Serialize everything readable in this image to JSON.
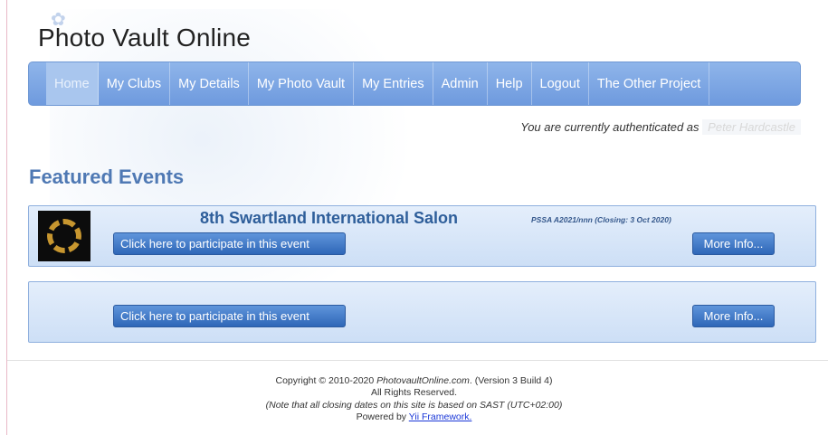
{
  "site": {
    "title": "Photo Vault Online"
  },
  "nav": {
    "items": [
      {
        "label": "Home",
        "active": true
      },
      {
        "label": "My Clubs"
      },
      {
        "label": "My Details"
      },
      {
        "label": "My Photo Vault"
      },
      {
        "label": "My Entries"
      },
      {
        "label": "Admin"
      },
      {
        "label": "Help"
      },
      {
        "label": "Logout"
      },
      {
        "label": "The Other Project"
      }
    ]
  },
  "auth": {
    "prefix": "You are currently authenticated as",
    "user": "Peter Hardcastle"
  },
  "featured": {
    "title": "Featured Events",
    "events": [
      {
        "title": "8th Swartland International Salon",
        "meta": "PSSA A2021/nnn (Closing: 3 Oct 2020)",
        "participate_label": "Click here to participate in this event",
        "more_label": "More Info..."
      },
      {
        "title": "",
        "meta": "",
        "participate_label": "Click here to participate in this event",
        "more_label": "More Info..."
      }
    ]
  },
  "footer": {
    "copyright_prefix": "Copyright © 2010-2020",
    "site_name": "PhotovaultOnline.com",
    "version": ". (Version 3 Build 4)",
    "rights": "All Rights Reserved.",
    "note": "(Note that all closing dates on this site is based on SAST (UTC+02:00)",
    "powered_prefix": "Powered by",
    "powered_link": "Yii Framework."
  },
  "colors": {
    "nav": "#7aa3e2",
    "accent": "#4f79b4",
    "button": "#3c74c4"
  }
}
